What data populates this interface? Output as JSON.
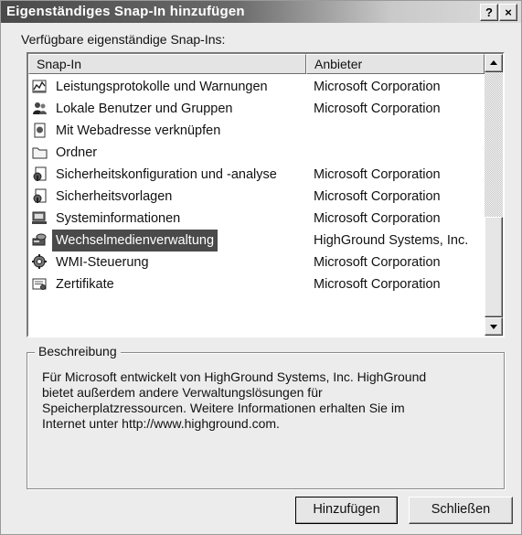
{
  "window": {
    "title": "Eigenständiges Snap-In hinzufügen",
    "help_label": "?",
    "close_label": "×"
  },
  "caption": "Verfügbare eigenständige Snap-Ins:",
  "list": {
    "columns": [
      "Snap-In",
      "Anbieter"
    ],
    "items": [
      {
        "name": "Leistungsprotokolle und Warnungen",
        "vendor": "Microsoft Corporation",
        "icon": "performance-logs-icon"
      },
      {
        "name": "Lokale Benutzer und Gruppen",
        "vendor": "Microsoft Corporation",
        "icon": "users-groups-icon"
      },
      {
        "name": "Mit Webadresse verknüpfen",
        "vendor": "",
        "icon": "web-link-icon"
      },
      {
        "name": "Ordner",
        "vendor": "",
        "icon": "folder-icon"
      },
      {
        "name": "Sicherheitskonfiguration und -analyse",
        "vendor": "Microsoft Corporation",
        "icon": "security-config-icon"
      },
      {
        "name": "Sicherheitsvorlagen",
        "vendor": "Microsoft Corporation",
        "icon": "security-templates-icon"
      },
      {
        "name": "Systeminformationen",
        "vendor": "Microsoft Corporation",
        "icon": "system-info-icon"
      },
      {
        "name": "Wechselmedienverwaltung",
        "vendor": "HighGround Systems, Inc.",
        "icon": "removable-media-icon",
        "selected": true
      },
      {
        "name": "WMI-Steuerung",
        "vendor": "Microsoft Corporation",
        "icon": "wmi-control-icon"
      },
      {
        "name": "Zertifikate",
        "vendor": "Microsoft Corporation",
        "icon": "certificates-icon"
      }
    ]
  },
  "description": {
    "legend": "Beschreibung",
    "text": "Für Microsoft entwickelt von HighGround Systems, Inc. HighGround\nbietet außerdem andere Verwaltungslösungen für\nSpeicherplatzressourcen. Weitere Informationen erhalten Sie im\nInternet unter http://www.highground.com."
  },
  "buttons": {
    "add": "Hinzufügen",
    "close": "Schließen"
  },
  "colors": {
    "selection": "#4a4a4a",
    "face": "#ececec"
  }
}
